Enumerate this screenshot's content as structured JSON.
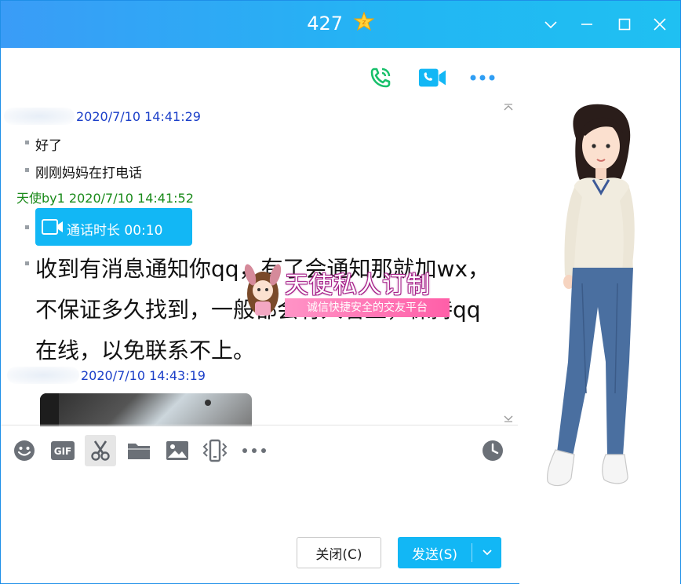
{
  "window": {
    "title": "427"
  },
  "chat": {
    "messages": [
      {
        "sender_time": "2020/7/10 14:41:29",
        "lines": [
          "好了",
          "刚刚妈妈在打电话"
        ]
      },
      {
        "sender": "天使by1",
        "time": "2020/7/10 14:41:52",
        "call_label": "通话时长 00:10",
        "text": "收到有消息通知你qq，有了会通知那就加wx，不保证多久找到，一般都会有人看上，保持qq在线，以免联系不上。"
      },
      {
        "sender_time": "2020/7/10 14:43:19"
      }
    ]
  },
  "watermark": {
    "title": "天使私人订制",
    "subtitle": "诚信快捷安全的交友平台"
  },
  "buttons": {
    "close": "关闭(C)",
    "send": "发送(S)"
  },
  "colors": {
    "accent": "#12b7f5",
    "sender_self": "#1a8a1a",
    "sender_other": "#1a3ec8",
    "call_green": "#18c06b"
  },
  "icons": [
    "phone-call-icon",
    "video-call-icon",
    "more-icon",
    "emoji-icon",
    "gif-icon",
    "scissors-icon",
    "folder-icon",
    "image-icon",
    "shake-icon",
    "more-icon",
    "history-icon"
  ]
}
